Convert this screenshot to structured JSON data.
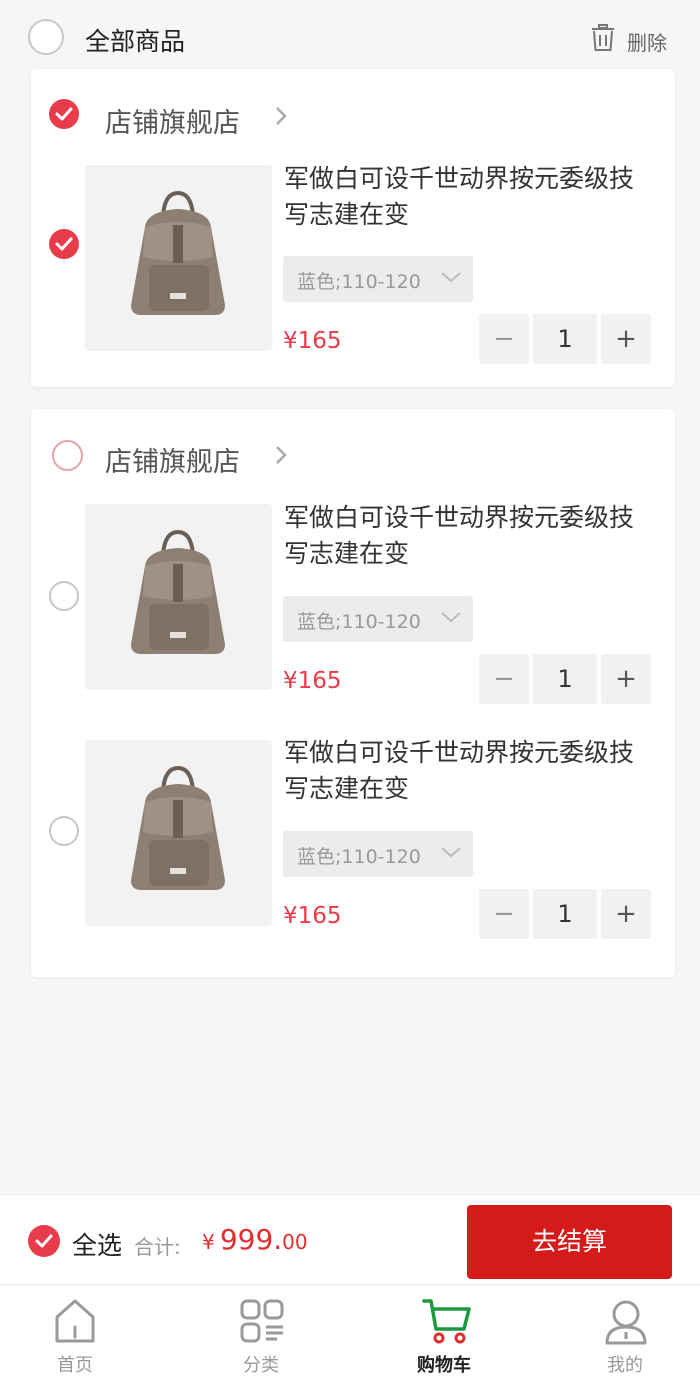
{
  "header": {
    "select_all_label": "全部商品",
    "delete_label": "删除"
  },
  "shops": [
    {
      "name": "店铺旗舰店",
      "checked": true,
      "items": [
        {
          "title": "军做白可设千世动界按元委级技写志建在变",
          "spec": "蓝色;110-120",
          "price": "¥165",
          "qty": "1",
          "checked": true
        }
      ]
    },
    {
      "name": "店铺旗舰店",
      "checked": false,
      "items": [
        {
          "title": "军做白可设千世动界按元委级技写志建在变",
          "spec": "蓝色;110-120",
          "price": "¥165",
          "qty": "1",
          "checked": false
        },
        {
          "title": "军做白可设千世动界按元委级技写志建在变",
          "spec": "蓝色;110-120",
          "price": "¥165",
          "qty": "1",
          "checked": false
        }
      ]
    }
  ],
  "stepper": {
    "minus": "−",
    "plus": "+"
  },
  "checkout": {
    "select_all_label": "全选",
    "total_label": "合计:",
    "currency": "¥",
    "total_int": "999.",
    "total_dec": "00",
    "button_label": "去结算"
  },
  "tabbar": {
    "items": [
      {
        "label": "首页",
        "icon": "home-icon"
      },
      {
        "label": "分类",
        "icon": "category-icon"
      },
      {
        "label": "购物车",
        "icon": "cart-icon",
        "active": true
      },
      {
        "label": "我的",
        "icon": "user-icon"
      }
    ]
  },
  "colors": {
    "accent": "#e83c4a",
    "checkout_button": "#d51a1a",
    "cart_active": "#1a9a3c"
  }
}
